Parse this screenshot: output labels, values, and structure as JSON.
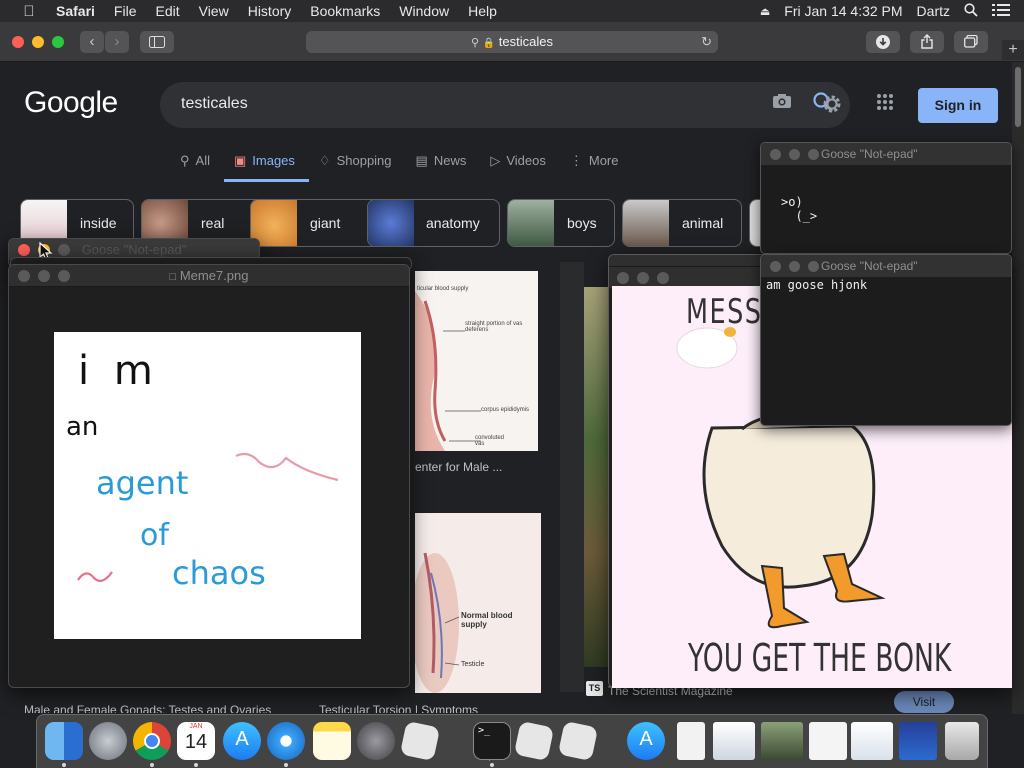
{
  "menubar": {
    "app": "Safari",
    "items": [
      "File",
      "Edit",
      "View",
      "History",
      "Bookmarks",
      "Window",
      "Help"
    ],
    "datetime": "Fri Jan 14  4:32 PM",
    "user": "Dartz"
  },
  "browser": {
    "address": "testicales"
  },
  "google": {
    "logo": "Google",
    "query": "testicales",
    "sign_in": "Sign in",
    "tabs": [
      {
        "icon": "search-icon",
        "label": "All",
        "active": false
      },
      {
        "icon": "image-icon",
        "label": "Images",
        "active": true
      },
      {
        "icon": "tag-icon",
        "label": "Shopping",
        "active": false
      },
      {
        "icon": "news-icon",
        "label": "News",
        "active": false
      },
      {
        "icon": "play-icon",
        "label": "Videos",
        "active": false
      },
      {
        "icon": "dots-icon",
        "label": "More",
        "active": false
      }
    ],
    "chips": [
      "inside",
      "real",
      "giant",
      "anatomy",
      "boys",
      "animal"
    ],
    "results": {
      "caption_center": "enter for Male ...",
      "caption_source": "The Scientist Magazine",
      "caption_source_badge": "TS",
      "caption_bottom_left": "Male and Female Gonads: Testes and Ovaries",
      "caption_bottom_mid": "Testicular Torsion | Symptoms",
      "visit": "Visit",
      "diagram1": {
        "label1": "ticular blood supply",
        "label2": "straight portion of vas deferens",
        "label3": "corpus epididymis",
        "label4": "convoluted vas"
      },
      "diagram2": {
        "label1": "Normal blood supply",
        "label2": "Testicle"
      }
    }
  },
  "meme_window": {
    "title": "Meme7.png",
    "behind_title": "Goose \"Not-epad\"",
    "text": {
      "line1": "i m",
      "line2": "an",
      "line3": "agent",
      "line4": "of",
      "line5": "chaos"
    }
  },
  "terminal_top": {
    "title": "Goose \"Not-epad\"",
    "line1": ">o)",
    "line2": "  (_>"
  },
  "terminal_bottom": {
    "title": "Goose \"Not-epad\"",
    "text": "am goose hjonk"
  },
  "poster": {
    "top": "MESS",
    "bottom": "YOU GET THE BONK"
  },
  "dock": {
    "calendar_month": "JAN",
    "calendar_day": "14",
    "items": [
      "finder",
      "launchpad",
      "chrome",
      "calendar",
      "app-store",
      "safari",
      "notes",
      "system-preferences",
      "roblox",
      "terminal",
      "roblox-studio",
      "roblox-player",
      "app-store-2",
      "document",
      "screenshot-1",
      "screenshot-2",
      "screenshot-3",
      "screenshot-4",
      "screenshot-5",
      "trash"
    ]
  },
  "colors": {
    "google_bg": "#202124",
    "accent_blue": "#8ab4f8",
    "poster_bg": "#fdeefa"
  }
}
